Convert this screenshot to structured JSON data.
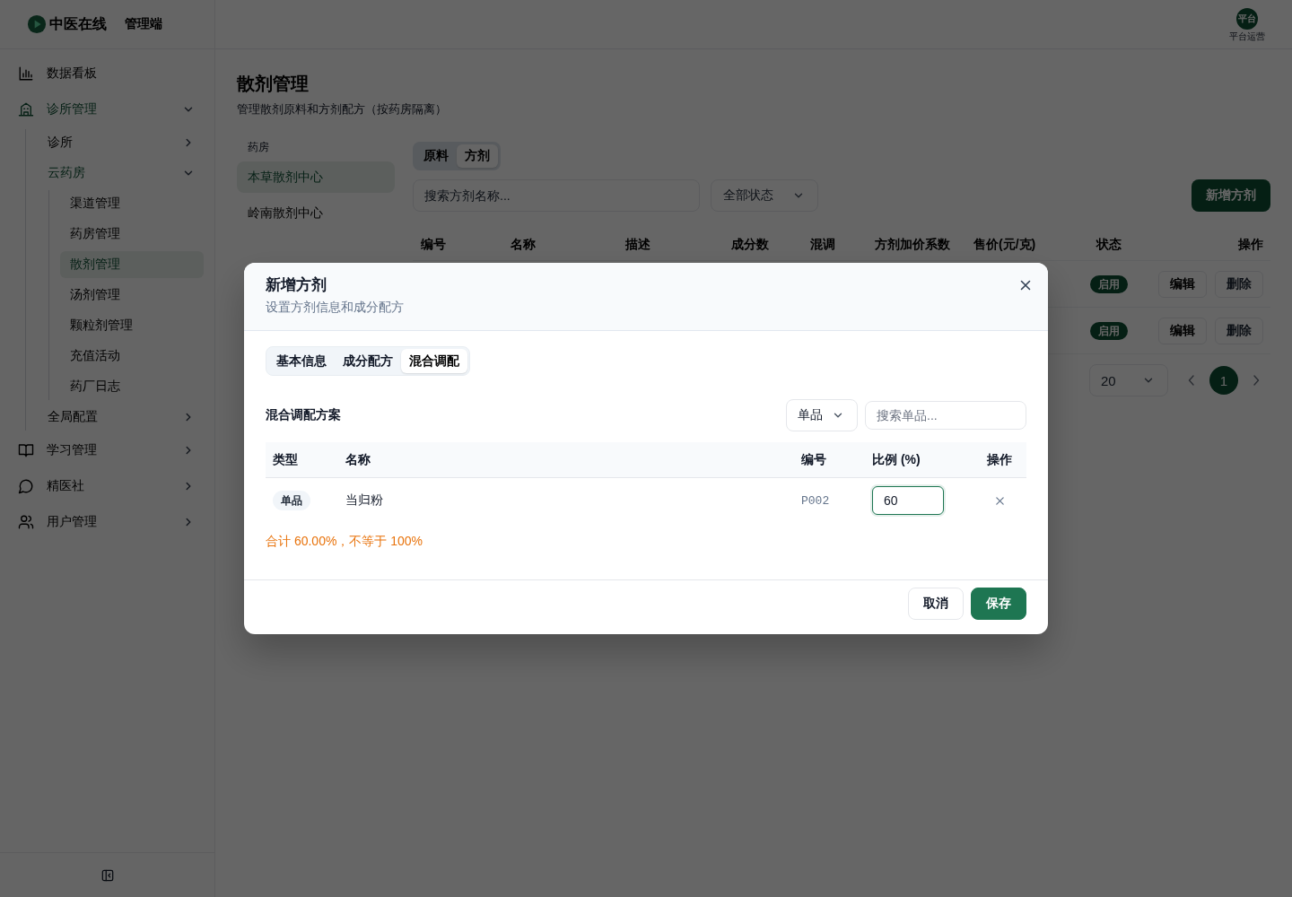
{
  "sidebar": {
    "brand": {
      "name": "中医在线",
      "suffix": "管理端"
    },
    "menu": [
      {
        "kind": "link",
        "label": "数据看板",
        "selected": false
      },
      {
        "kind": "group",
        "label": "诊所管理",
        "selected": true,
        "expanded": true,
        "children": [
          {
            "kind": "group",
            "label": "诊所",
            "selected": false,
            "expanded": false
          },
          {
            "kind": "group",
            "label": "云药房",
            "selected": true,
            "expanded": true,
            "children": [
              {
                "kind": "link",
                "label": "渠道管理",
                "selected": false
              },
              {
                "kind": "link",
                "label": "药房管理",
                "selected": false
              },
              {
                "kind": "link",
                "label": "散剂管理",
                "selected": true
              },
              {
                "kind": "link",
                "label": "汤剂管理",
                "selected": false
              },
              {
                "kind": "link",
                "label": "颗粒剂管理",
                "selected": false
              },
              {
                "kind": "link",
                "label": "充值活动",
                "selected": false
              },
              {
                "kind": "link",
                "label": "药厂日志",
                "selected": false
              }
            ]
          },
          {
            "kind": "group",
            "label": "全局配置",
            "selected": false,
            "expanded": false
          }
        ]
      },
      {
        "kind": "group",
        "label": "学习管理",
        "selected": false,
        "expanded": false
      },
      {
        "kind": "group",
        "label": "精医社",
        "selected": false,
        "expanded": false
      },
      {
        "kind": "group",
        "label": "用户管理",
        "selected": false,
        "expanded": false
      }
    ]
  },
  "header": {
    "user": {
      "avatar": "平台",
      "role": "平台运营"
    }
  },
  "page": {
    "title": "散剂管理",
    "subtitle": "管理散剂原料和方剂配方（按药房隔离）"
  },
  "pharmacies": {
    "label": "药房",
    "items": [
      {
        "label": "本草散剂中心",
        "selected": true
      },
      {
        "label": "岭南散剂中心",
        "selected": false
      }
    ]
  },
  "type_tabs": [
    {
      "label": "原料",
      "selected": false
    },
    {
      "label": "方剂",
      "selected": true
    }
  ],
  "toolbar": {
    "search": {
      "placeholder": "搜索方剂名称..."
    },
    "status_select": {
      "placeholder": "全部状态"
    },
    "add_button": "新增方剂"
  },
  "table": {
    "columns": [
      "编号",
      "名称",
      "描述",
      "成分数",
      "混调",
      "方剂加价系数",
      "售价(元/克)",
      "状态",
      "操作"
    ],
    "rows": [
      {
        "status": "启用",
        "actions": [
          {
            "label": "编辑",
            "kind": "default"
          },
          {
            "label": "删除",
            "kind": "secondary"
          }
        ]
      },
      {
        "status": "启用",
        "actions": [
          {
            "label": "编辑",
            "kind": "default"
          },
          {
            "label": "删除",
            "kind": "secondary"
          }
        ]
      }
    ]
  },
  "pagination": {
    "page_size": "20",
    "pages": [
      {
        "label": "1",
        "selected": true
      }
    ]
  },
  "dialog": {
    "title": "新增方剂",
    "subtitle": "设置方剂信息和成分配方",
    "tabs": [
      {
        "label": "基本信息",
        "selected": false
      },
      {
        "label": "成分配方",
        "selected": false
      },
      {
        "label": "混合调配",
        "selected": true
      }
    ],
    "section_title": "混合调配方案",
    "type_select": {
      "value": "单品"
    },
    "search": {
      "placeholder": "搜索单品..."
    },
    "table": {
      "columns": [
        "类型",
        "名称",
        "编号",
        "比例 (%)",
        "操作"
      ],
      "rows": [
        {
          "type": "单品",
          "name": "当归粉",
          "code": "P002",
          "ratio": {
            "value": "60",
            "focused": true
          }
        }
      ]
    },
    "warning": "合计 60.00%，不等于 100%",
    "buttons": [
      {
        "label": "取消",
        "kind": "secondary"
      },
      {
        "label": "保存",
        "kind": "primary"
      }
    ]
  }
}
